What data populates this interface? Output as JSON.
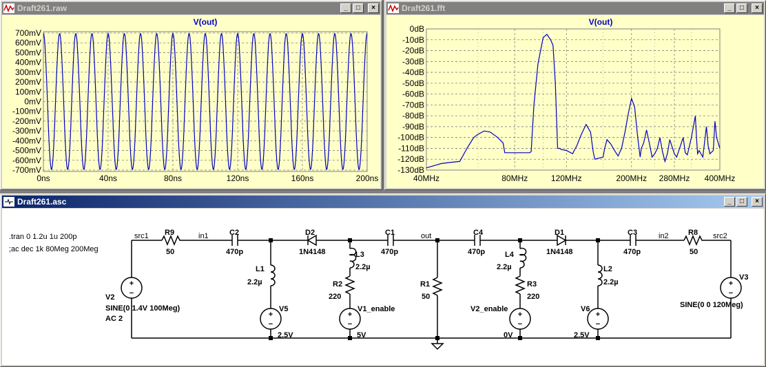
{
  "windows": {
    "raw": {
      "title": "Draft261.raw",
      "trace_label": "V(out)",
      "y_ticks": [
        "700mV",
        "600mV",
        "500mV",
        "400mV",
        "300mV",
        "200mV",
        "100mV",
        "0mV",
        "-100mV",
        "-200mV",
        "-300mV",
        "-400mV",
        "-500mV",
        "-600mV",
        "-700mV"
      ],
      "x_ticks": [
        "0ns",
        "40ns",
        "80ns",
        "120ns",
        "160ns",
        "200ns"
      ]
    },
    "fft": {
      "title": "Draft261.fft",
      "trace_label": "V(out)",
      "y_ticks": [
        "0dB",
        "-10dB",
        "-20dB",
        "-30dB",
        "-40dB",
        "-50dB",
        "-60dB",
        "-70dB",
        "-80dB",
        "-90dB",
        "-100dB",
        "-110dB",
        "-120dB",
        "-130dB"
      ],
      "x_ticks": [
        "40MHz",
        "80MHz",
        "120MHz",
        "200MHz",
        "280MHz",
        "400MHz"
      ]
    },
    "asc": {
      "title": "Draft261.asc"
    }
  },
  "buttons": {
    "minimize": "_",
    "restore": "□",
    "close": "×"
  },
  "colors": {
    "trace": "#0000c0",
    "plot_bg": "#ffffc8",
    "grid": "#808080",
    "wire": "#000000",
    "active_title": "#0a246a"
  },
  "chart_data": [
    {
      "type": "line",
      "title": "V(out)",
      "xlabel": "",
      "ylabel": "",
      "x_unit": "ns",
      "y_unit": "mV",
      "xlim": [
        0,
        200
      ],
      "ylim": [
        -700,
        700
      ],
      "series": [
        {
          "name": "V(out)",
          "shape": "sine",
          "amplitude": 680,
          "frequency_MHz": 100,
          "values_note": ""
        }
      ],
      "sine_cycles": 20
    },
    {
      "type": "line",
      "title": "V(out)",
      "x_scale": "log",
      "xlim": [
        40,
        400
      ],
      "ylim": [
        -130,
        0
      ],
      "series": [
        {
          "name": "V(out)",
          "x": [
            40,
            45,
            48,
            52,
            55,
            58,
            60,
            63,
            66,
            70,
            73,
            74,
            90,
            91,
            93,
            96,
            100,
            103,
            106,
            108,
            110,
            112,
            114,
            115,
            120,
            126,
            127,
            130,
            135,
            140,
            145,
            148,
            150,
            160,
            162,
            165,
            170,
            175,
            180,
            185,
            190,
            195,
            200,
            205,
            210,
            214,
            216,
            220,
            225,
            230,
            235,
            240,
            245,
            250,
            255,
            260,
            265,
            270,
            280,
            285,
            290,
            300,
            305,
            310,
            320,
            330,
            333,
            336,
            340,
            350,
            360,
            365,
            370,
            380,
            385,
            390,
            400
          ],
          "y": [
            -128,
            -124,
            -123,
            -122,
            -110,
            -100,
            -97,
            -94,
            -95,
            -100,
            -105,
            -114,
            -114,
            -113,
            -70,
            -32,
            -8,
            -5,
            -10,
            -15,
            -50,
            -110,
            -110,
            -111,
            -112,
            -115,
            -113,
            -108,
            -97,
            -88,
            -95,
            -113,
            -120,
            -118,
            -110,
            -102,
            -106,
            -112,
            -117,
            -110,
            -95,
            -78,
            -64,
            -72,
            -100,
            -118,
            -110,
            -105,
            -93,
            -105,
            -118,
            -115,
            -110,
            -100,
            -113,
            -122,
            -115,
            -102,
            -115,
            -118,
            -112,
            -100,
            -114,
            -116,
            -100,
            -80,
            -100,
            -115,
            -112,
            -118,
            -90,
            -108,
            -115,
            -112,
            -85,
            -100,
            -110
          ]
        }
      ]
    }
  ],
  "schematic": {
    "directives": [
      ".tran 0 1.2u 1u 200p",
      ";ac dec 1k 80Meg 200Meg"
    ],
    "nets": {
      "src1": "src1",
      "in1": "in1",
      "out": "out",
      "in2": "in2",
      "src2": "src2",
      "v1_enable": "V1_enable",
      "v2_enable": "V2_enable"
    },
    "parts": {
      "R9": {
        "name": "R9",
        "value": "50"
      },
      "C2": {
        "name": "C2",
        "value": "470p"
      },
      "D2": {
        "name": "D2",
        "value": "1N4148"
      },
      "C1": {
        "name": "C1",
        "value": "470p"
      },
      "C4": {
        "name": "C4",
        "value": "470p"
      },
      "D1": {
        "name": "D1",
        "value": "1N4148"
      },
      "C3": {
        "name": "C3",
        "value": "470p"
      },
      "R8": {
        "name": "R8",
        "value": "50"
      },
      "L1": {
        "name": "L1",
        "value": "2.2µ"
      },
      "L3": {
        "name": "L3",
        "value": "2.2µ"
      },
      "L4": {
        "name": "L4",
        "value": "2.2µ"
      },
      "L2": {
        "name": "L2",
        "value": "2.2µ"
      },
      "R2": {
        "name": "R2",
        "value": "220"
      },
      "R3": {
        "name": "R3",
        "value": "220"
      },
      "R1": {
        "name": "R1",
        "value": "50"
      },
      "V2": {
        "name": "V2",
        "value": "SINE(0 1.4V 100Meg)",
        "value2": "AC 2"
      },
      "V3": {
        "name": "V3",
        "value": "SINE(0 0 120Meg)"
      },
      "V5": {
        "name": "V5",
        "value": "2.5V"
      },
      "V6": {
        "name": "V6",
        "value": "2.5V"
      },
      "V1": {
        "name": "",
        "value": "5V"
      },
      "V4": {
        "name": "",
        "value": "0V"
      }
    }
  }
}
